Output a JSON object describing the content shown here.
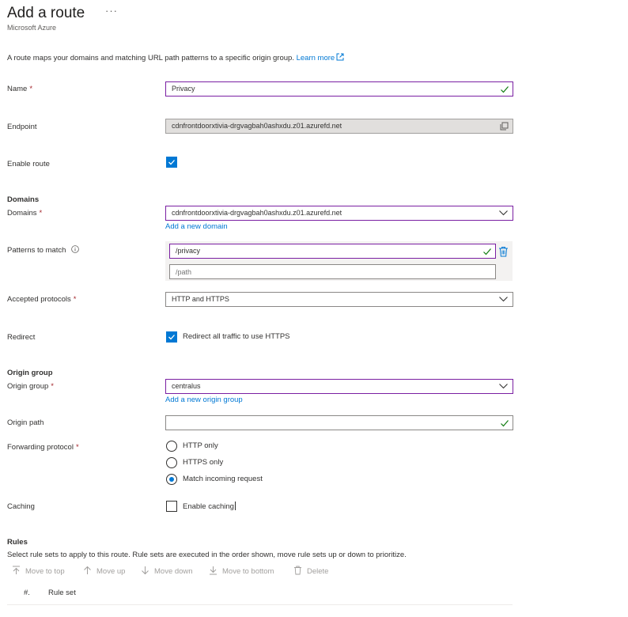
{
  "header": {
    "title": "Add a route",
    "more": "···",
    "subtitle": "Microsoft Azure"
  },
  "description": {
    "text": "A route maps your domains and matching URL path patterns to a specific origin group.",
    "link": "Learn more"
  },
  "form": {
    "name": {
      "label": "Name",
      "required": "*",
      "value": "Privacy"
    },
    "endpoint": {
      "label": "Endpoint",
      "value": "cdnfrontdoorxtivia-drgvagbah0ashxdu.z01.azurefd.net"
    },
    "enable_route": {
      "label": "Enable route",
      "checked": true
    },
    "domains_section": "Domains",
    "domains": {
      "label": "Domains",
      "required": "*",
      "value": "cdnfrontdoorxtivia-drgvagbah0ashxdu.z01.azurefd.net",
      "add_link": "Add a new domain"
    },
    "patterns": {
      "label": "Patterns to match",
      "items": [
        "/privacy"
      ],
      "placeholder": "/path"
    },
    "protocols": {
      "label": "Accepted protocols",
      "required": "*",
      "value": "HTTP and HTTPS"
    },
    "redirect": {
      "label": "Redirect",
      "option": "Redirect all traffic to use HTTPS",
      "checked": true
    },
    "origin_section": "Origin group",
    "origin_group": {
      "label": "Origin group",
      "required": "*",
      "value": "centralus",
      "add_link": "Add a new origin group"
    },
    "origin_path": {
      "label": "Origin path",
      "value": ""
    },
    "forwarding": {
      "label": "Forwarding protocol",
      "required": "*",
      "options": [
        "HTTP only",
        "HTTPS only",
        "Match incoming request"
      ],
      "selected": "Match incoming request"
    },
    "caching": {
      "label": "Caching",
      "option": "Enable caching",
      "checked": false
    }
  },
  "rules": {
    "title": "Rules",
    "description": "Select rule sets to apply to this route. Rule sets are executed in the order shown, move rule sets up or down to prioritize.",
    "toolbar": [
      "Move to top",
      "Move up",
      "Move down",
      "Move to bottom",
      "Delete"
    ],
    "columns": [
      "#.",
      "Rule set"
    ]
  },
  "colors": {
    "accent": "#0078d4",
    "focus_border": "#7a1fa2",
    "valid_check": "#107c10",
    "required": "#a4262c"
  }
}
